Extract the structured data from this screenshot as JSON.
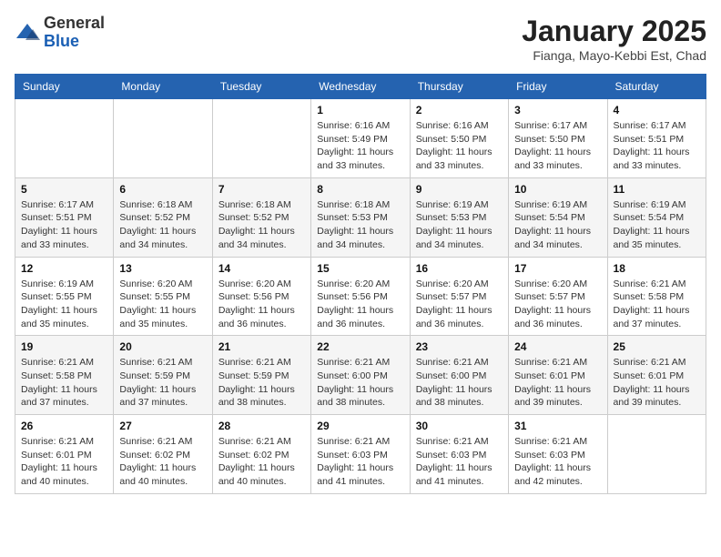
{
  "logo": {
    "general": "General",
    "blue": "Blue"
  },
  "header": {
    "month": "January 2025",
    "location": "Fianga, Mayo-Kebbi Est, Chad"
  },
  "weekdays": [
    "Sunday",
    "Monday",
    "Tuesday",
    "Wednesday",
    "Thursday",
    "Friday",
    "Saturday"
  ],
  "weeks": [
    [
      {
        "day": "",
        "info": ""
      },
      {
        "day": "",
        "info": ""
      },
      {
        "day": "",
        "info": ""
      },
      {
        "day": "1",
        "info": "Sunrise: 6:16 AM\nSunset: 5:49 PM\nDaylight: 11 hours and 33 minutes."
      },
      {
        "day": "2",
        "info": "Sunrise: 6:16 AM\nSunset: 5:50 PM\nDaylight: 11 hours and 33 minutes."
      },
      {
        "day": "3",
        "info": "Sunrise: 6:17 AM\nSunset: 5:50 PM\nDaylight: 11 hours and 33 minutes."
      },
      {
        "day": "4",
        "info": "Sunrise: 6:17 AM\nSunset: 5:51 PM\nDaylight: 11 hours and 33 minutes."
      }
    ],
    [
      {
        "day": "5",
        "info": "Sunrise: 6:17 AM\nSunset: 5:51 PM\nDaylight: 11 hours and 33 minutes."
      },
      {
        "day": "6",
        "info": "Sunrise: 6:18 AM\nSunset: 5:52 PM\nDaylight: 11 hours and 34 minutes."
      },
      {
        "day": "7",
        "info": "Sunrise: 6:18 AM\nSunset: 5:52 PM\nDaylight: 11 hours and 34 minutes."
      },
      {
        "day": "8",
        "info": "Sunrise: 6:18 AM\nSunset: 5:53 PM\nDaylight: 11 hours and 34 minutes."
      },
      {
        "day": "9",
        "info": "Sunrise: 6:19 AM\nSunset: 5:53 PM\nDaylight: 11 hours and 34 minutes."
      },
      {
        "day": "10",
        "info": "Sunrise: 6:19 AM\nSunset: 5:54 PM\nDaylight: 11 hours and 34 minutes."
      },
      {
        "day": "11",
        "info": "Sunrise: 6:19 AM\nSunset: 5:54 PM\nDaylight: 11 hours and 35 minutes."
      }
    ],
    [
      {
        "day": "12",
        "info": "Sunrise: 6:19 AM\nSunset: 5:55 PM\nDaylight: 11 hours and 35 minutes."
      },
      {
        "day": "13",
        "info": "Sunrise: 6:20 AM\nSunset: 5:55 PM\nDaylight: 11 hours and 35 minutes."
      },
      {
        "day": "14",
        "info": "Sunrise: 6:20 AM\nSunset: 5:56 PM\nDaylight: 11 hours and 36 minutes."
      },
      {
        "day": "15",
        "info": "Sunrise: 6:20 AM\nSunset: 5:56 PM\nDaylight: 11 hours and 36 minutes."
      },
      {
        "day": "16",
        "info": "Sunrise: 6:20 AM\nSunset: 5:57 PM\nDaylight: 11 hours and 36 minutes."
      },
      {
        "day": "17",
        "info": "Sunrise: 6:20 AM\nSunset: 5:57 PM\nDaylight: 11 hours and 36 minutes."
      },
      {
        "day": "18",
        "info": "Sunrise: 6:21 AM\nSunset: 5:58 PM\nDaylight: 11 hours and 37 minutes."
      }
    ],
    [
      {
        "day": "19",
        "info": "Sunrise: 6:21 AM\nSunset: 5:58 PM\nDaylight: 11 hours and 37 minutes."
      },
      {
        "day": "20",
        "info": "Sunrise: 6:21 AM\nSunset: 5:59 PM\nDaylight: 11 hours and 37 minutes."
      },
      {
        "day": "21",
        "info": "Sunrise: 6:21 AM\nSunset: 5:59 PM\nDaylight: 11 hours and 38 minutes."
      },
      {
        "day": "22",
        "info": "Sunrise: 6:21 AM\nSunset: 6:00 PM\nDaylight: 11 hours and 38 minutes."
      },
      {
        "day": "23",
        "info": "Sunrise: 6:21 AM\nSunset: 6:00 PM\nDaylight: 11 hours and 38 minutes."
      },
      {
        "day": "24",
        "info": "Sunrise: 6:21 AM\nSunset: 6:01 PM\nDaylight: 11 hours and 39 minutes."
      },
      {
        "day": "25",
        "info": "Sunrise: 6:21 AM\nSunset: 6:01 PM\nDaylight: 11 hours and 39 minutes."
      }
    ],
    [
      {
        "day": "26",
        "info": "Sunrise: 6:21 AM\nSunset: 6:01 PM\nDaylight: 11 hours and 40 minutes."
      },
      {
        "day": "27",
        "info": "Sunrise: 6:21 AM\nSunset: 6:02 PM\nDaylight: 11 hours and 40 minutes."
      },
      {
        "day": "28",
        "info": "Sunrise: 6:21 AM\nSunset: 6:02 PM\nDaylight: 11 hours and 40 minutes."
      },
      {
        "day": "29",
        "info": "Sunrise: 6:21 AM\nSunset: 6:03 PM\nDaylight: 11 hours and 41 minutes."
      },
      {
        "day": "30",
        "info": "Sunrise: 6:21 AM\nSunset: 6:03 PM\nDaylight: 11 hours and 41 minutes."
      },
      {
        "day": "31",
        "info": "Sunrise: 6:21 AM\nSunset: 6:03 PM\nDaylight: 11 hours and 42 minutes."
      },
      {
        "day": "",
        "info": ""
      }
    ]
  ]
}
